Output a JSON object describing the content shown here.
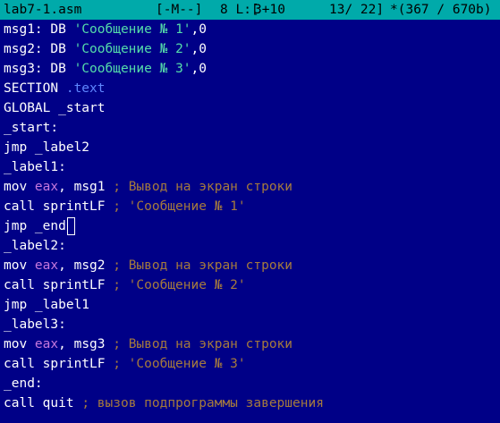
{
  "status_bar": {
    "filename": "lab7-1.asm",
    "flags": "[-M--]",
    "line_count": "8 L:[",
    "position": "3+10",
    "lines": "13/ 22]",
    "char_info": "*(367 / 670b)"
  },
  "code": {
    "l1": {
      "a": "msg1: DB ",
      "b": "'Сообщение № 1'",
      "c": ",0"
    },
    "l2": {
      "a": "msg2: DB ",
      "b": "'Сообщение № 2'",
      "c": ",0"
    },
    "l3": {
      "a": "msg3: DB ",
      "b": "'Сообщение № 3'",
      "c": ",0"
    },
    "l4": {
      "a": "SECTION ",
      "b": ".text"
    },
    "l5": {
      "a": "GLOBAL _start"
    },
    "l6": {
      "a": "_start:"
    },
    "l7": {
      "a": "jmp _label2"
    },
    "l8": {
      "a": "_label1:"
    },
    "l9": {
      "a": "mov ",
      "b": "eax",
      "c": ", msg1 ",
      "d": "; Вывод на экран строки"
    },
    "l10": {
      "a": "call sprintLF ",
      "b": "; 'Сообщение № 1'"
    },
    "l11": {
      "a": "jmp _end"
    },
    "l12": {
      "a": "_label2:"
    },
    "l13": {
      "a": "mov ",
      "b": "eax",
      "c": ", msg2 ",
      "d": "; Вывод на экран строки"
    },
    "l14": {
      "a": "call sprintLF ",
      "b": "; 'Сообщение № 2'"
    },
    "l15": {
      "a": "jmp _label1"
    },
    "l16": {
      "a": "_label3:"
    },
    "l17": {
      "a": "mov ",
      "b": "eax",
      "c": ", msg3 ",
      "d": "; Вывод на экран строки"
    },
    "l18": {
      "a": "call sprintLF ",
      "b": "; 'Сообщение № 3'"
    },
    "l19": {
      "a": "_end:"
    },
    "l20": {
      "a": "call quit ",
      "b": "; вызов подпрограммы завершения"
    }
  },
  "colors": {
    "background": "#000087",
    "status_bar": "#00aaaa",
    "string": "#55ddaa",
    "keyword": "#5f87ff",
    "register": "#c678dd",
    "comment": "#a57a3e"
  }
}
